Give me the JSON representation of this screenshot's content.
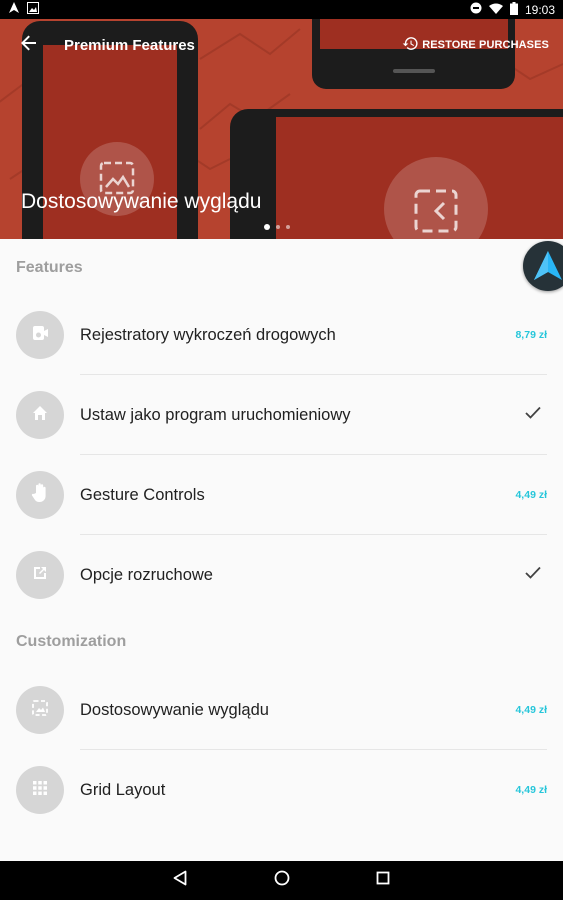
{
  "status_bar": {
    "time": "19:03",
    "left_icons": [
      "app-notification-icon",
      "image-notification-icon"
    ],
    "right_icons": [
      "do-not-disturb-icon",
      "wifi-icon",
      "battery-icon"
    ]
  },
  "app_bar": {
    "title": "Premium Features",
    "restore_label": "RESTORE PURCHASES",
    "back_icon": "arrow-back-icon",
    "restore_icon": "history-icon"
  },
  "hero": {
    "caption": "Dostosowywanie wyglądu",
    "pages": 3,
    "active_page": 0,
    "background_color": "#b6432f"
  },
  "sections": [
    {
      "title": "Features",
      "items": [
        {
          "label": "Rejestratory wykroczeń drogowych",
          "price": "8,79 zł",
          "owned": false,
          "icon": "dashcam-icon"
        },
        {
          "label": "Ustaw jako program uruchomieniowy",
          "price": "",
          "owned": true,
          "icon": "home-icon"
        },
        {
          "label": "Gesture Controls",
          "price": "4,49 zł",
          "owned": false,
          "icon": "hand-icon"
        },
        {
          "label": "Opcje rozruchowe",
          "price": "",
          "owned": true,
          "icon": "open-in-new-icon"
        }
      ]
    },
    {
      "title": "Customization",
      "items": [
        {
          "label": "Dostosowywanie wyglądu",
          "price": "4,49 zł",
          "owned": false,
          "icon": "wallpaper-icon"
        },
        {
          "label": "Grid Layout",
          "price": "4,49 zł",
          "owned": false,
          "icon": "grid-icon"
        }
      ]
    }
  ],
  "colors": {
    "accent": "#26c6da",
    "section_header": "#9e9e9e",
    "icon_circle": "#d6d6d6"
  },
  "nav_bar": {
    "back_icon": "nav-back-icon",
    "home_icon": "nav-home-icon",
    "recents_icon": "nav-recents-icon"
  }
}
